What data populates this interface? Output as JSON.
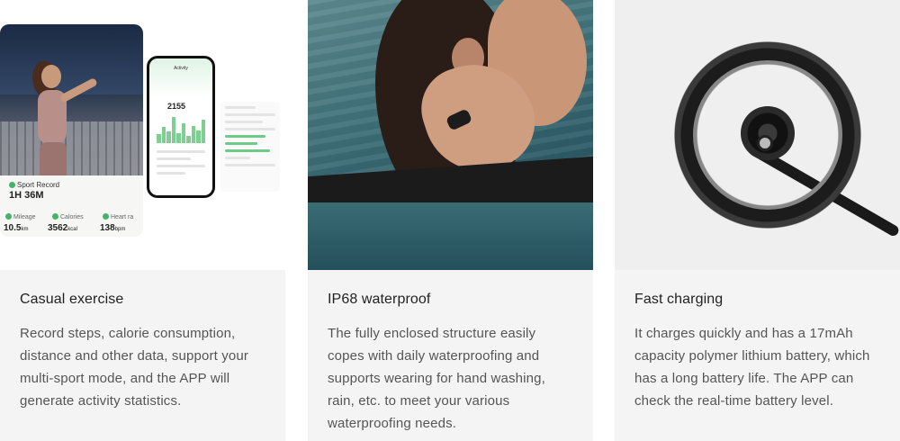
{
  "cards": [
    {
      "title": "Casual exercise",
      "body": "Record steps, calorie consumption, distance and other data, support your multi-sport mode, and the APP will generate activity statistics.",
      "image": {
        "sport_record_label": "Sport Record",
        "sport_time": "1H 36M",
        "stats": [
          {
            "label": "Mileage",
            "value": "10.5",
            "unit": "km"
          },
          {
            "label": "Calories",
            "value": "3562",
            "unit": "kcal"
          },
          {
            "label": "Heart ra",
            "value": "138",
            "unit": "bpm"
          }
        ],
        "phone_title": "Activity",
        "phone_value": "2155"
      }
    },
    {
      "title": "IP68 waterproof",
      "body": "The fully enclosed structure easily copes with daily waterproofing and supports wearing for hand washing, rain, etc. to meet your various waterproofing needs."
    },
    {
      "title": "Fast charging",
      "body": "It charges quickly and has a 17mAh capacity polymer lithium battery, which has a long battery life. The APP can check the real-time battery level."
    }
  ]
}
